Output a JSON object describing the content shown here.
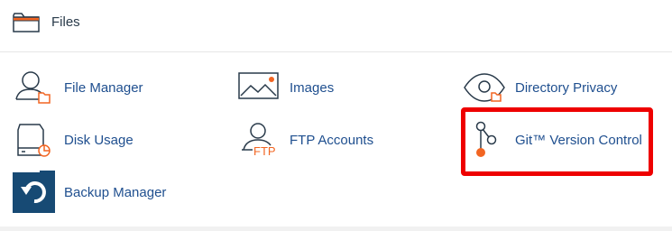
{
  "section": {
    "title": "Files",
    "icon": "folder-icon"
  },
  "items": [
    {
      "label": "File Manager",
      "icon": "file-manager-icon"
    },
    {
      "label": "Images",
      "icon": "images-icon"
    },
    {
      "label": "Directory Privacy",
      "icon": "directory-privacy-icon"
    },
    {
      "label": "Disk Usage",
      "icon": "disk-usage-icon"
    },
    {
      "label": "FTP Accounts",
      "icon": "ftp-accounts-icon",
      "icon_text": "FTP"
    },
    {
      "label": "Git™ Version Control",
      "icon": "git-version-control-icon"
    },
    {
      "label": "Backup Manager",
      "icon": "backup-manager-icon"
    }
  ],
  "highlight": {
    "target": "Git™ Version Control",
    "color": "#ee0000"
  },
  "colors": {
    "link": "#1f4f8f",
    "accent_orange": "#f26522",
    "icon_dark": "#293a4a",
    "backup_blue": "#174a74"
  }
}
